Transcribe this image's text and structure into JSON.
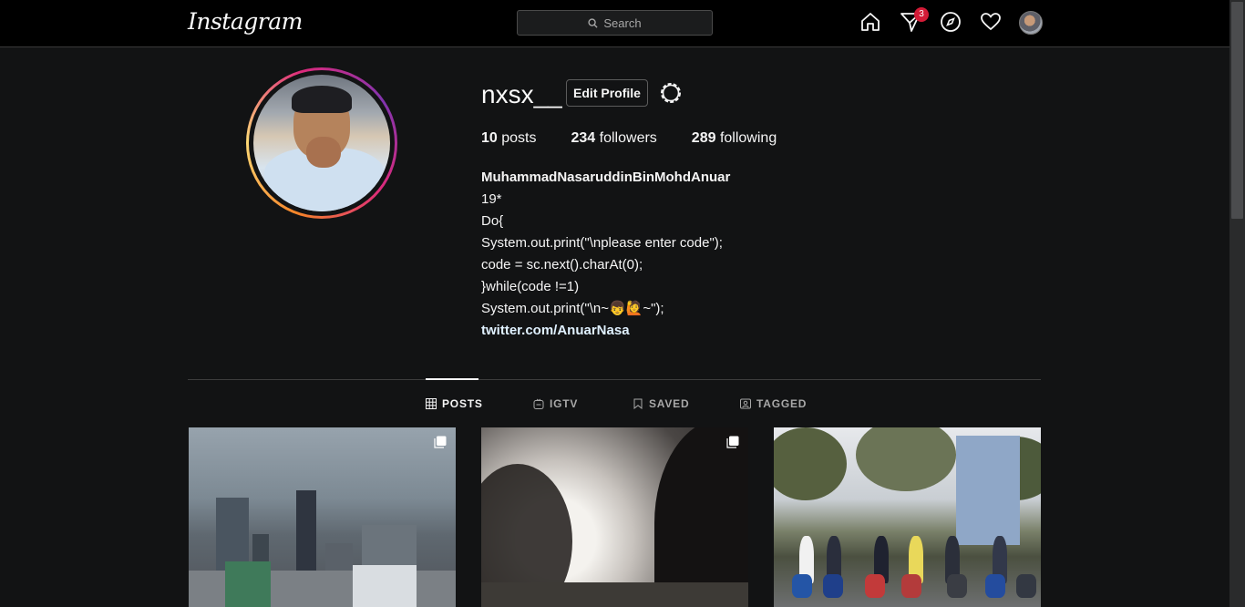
{
  "nav": {
    "logo": "Instagram",
    "search_placeholder": "Search",
    "activity_badge": "3"
  },
  "profile": {
    "username": "nxsx__",
    "edit_label": "Edit Profile",
    "posts_count": "10",
    "posts_label": "posts",
    "followers_count": "234",
    "followers_label": "followers",
    "following_count": "289",
    "following_label": "following",
    "bio": {
      "full_name": "MuhammadNasaruddinBinMohdAnuar",
      "lines": [
        "19*",
        "Do{",
        "System.out.print(\"\\nplease enter code\");",
        "code = sc.next().charAt(0);",
        "}while(code !=1)",
        "System.out.print(\"\\n~👦🙋~\");"
      ],
      "link": "twitter.com/AnuarNasa"
    }
  },
  "tabs": [
    {
      "label": "POSTS",
      "icon": "grid-icon",
      "active": true
    },
    {
      "label": "IGTV",
      "icon": "igtv-icon",
      "active": false
    },
    {
      "label": "SAVED",
      "icon": "bookmark-icon",
      "active": false
    },
    {
      "label": "TAGGED",
      "icon": "tagged-icon",
      "active": false
    }
  ],
  "colors": {
    "background": "#121314",
    "badge": "#d41b37",
    "link": "#e0f1ff"
  }
}
